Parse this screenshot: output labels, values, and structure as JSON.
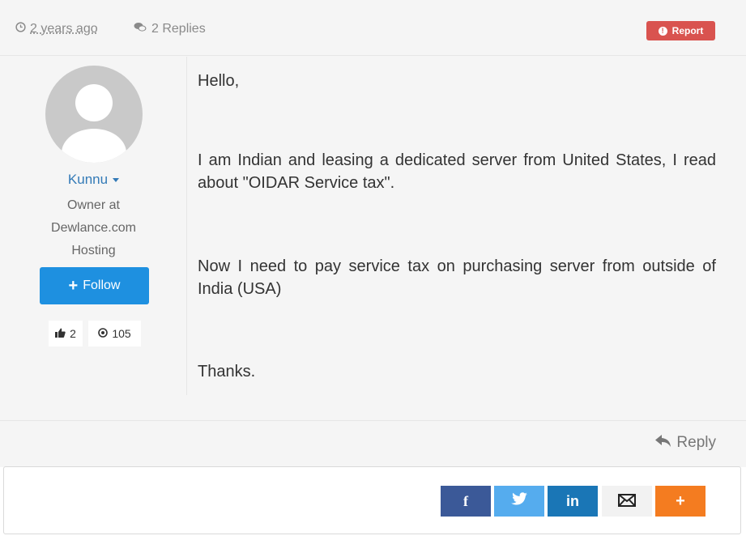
{
  "meta": {
    "time_label": "2 years ago",
    "replies_label": "2 Replies",
    "report_label": "Report",
    "colors": {
      "report": "#d9534f",
      "link": "#337ab7"
    }
  },
  "author": {
    "name": "Kunnu",
    "title": "Owner at Dewlance.com Hosting",
    "follow_label": "Follow",
    "likes": "2",
    "points": "105"
  },
  "post": {
    "paragraphs": [
      "Hello,",
      "I am Indian and leasing a dedicated server from United States, I read about \"OIDAR Service tax\".",
      "Now I need to pay service tax on purchasing server from outside of India (USA)",
      "Thanks."
    ]
  },
  "actions": {
    "reply_label": "Reply"
  },
  "share": {
    "buttons": [
      {
        "name": "facebook",
        "glyph": "f",
        "color": "#3b5998"
      },
      {
        "name": "twitter",
        "glyph": "❧",
        "color": "#55acee"
      },
      {
        "name": "linkedin",
        "glyph": "in",
        "color": "#1a76b6"
      },
      {
        "name": "email",
        "glyph": "✉",
        "color": "#f2f2f2"
      },
      {
        "name": "more",
        "glyph": "+",
        "color": "#f47c20"
      }
    ]
  }
}
